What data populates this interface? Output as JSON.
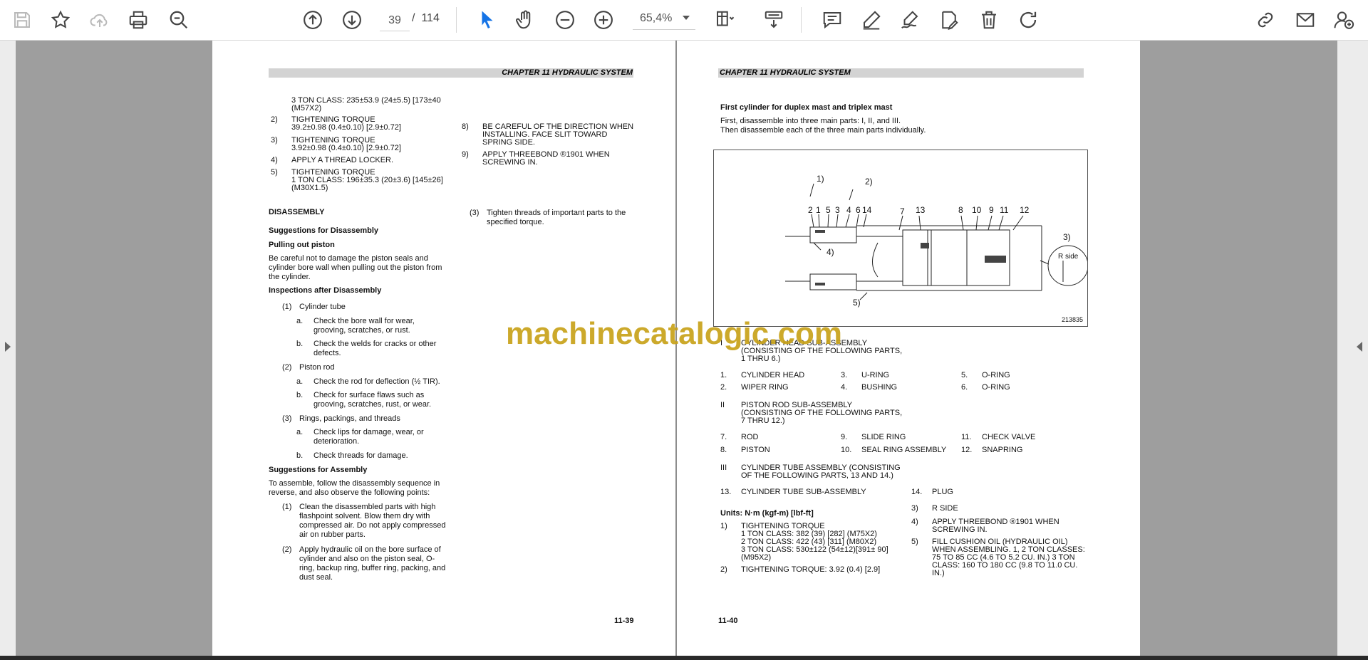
{
  "toolbar": {
    "icons": [
      "save-icon",
      "bookmark-star-icon",
      "cloud-upload-icon",
      "print-icon",
      "zoom-search-icon",
      "page-up-icon",
      "page-down-icon",
      "select-cursor-icon",
      "hand-tool-icon",
      "zoom-out-icon",
      "zoom-in-icon",
      "fit-page-icon",
      "scroll-mode-icon",
      "comment-icon",
      "highlight-pen-icon",
      "draw-sign-icon",
      "edit-text-icon",
      "delete-icon",
      "rotate-icon",
      "share-link-icon",
      "email-icon",
      "add-user-icon"
    ],
    "current_page": "39",
    "page_separator": "/",
    "total_pages": "114",
    "zoom": "65,4%"
  },
  "watermark": "machinecatalogic.com",
  "left_page": {
    "chapter": "CHAPTER 11 HYDRAULIC SYSTEM",
    "page_number": "11-39",
    "col1": {
      "t1a": "3 TON CLASS: 235±53.9 (24±5.5) [173±40",
      "t1b": "(M57X2)",
      "n2": "2)",
      "t2a": "TIGHTENING TORQUE",
      "t2b": "39.2±0.98 (0.4±0.10) [2.9±0.72]",
      "n3": "3)",
      "t3a": "TIGHTENING TORQUE",
      "t3b": "3.92±0.98 (0.4±0.10) [2.9±0.72]",
      "n4": "4)",
      "t4": "APPLY A THREAD LOCKER.",
      "n5": "5)",
      "t5a": "TIGHTENING TORQUE",
      "t5b": "1 TON CLASS: 196±35.3 (20±3.6) [145±26]",
      "t5c": "(M30X1.5)",
      "disassembly": "DISASSEMBLY",
      "sugg_dis": "Suggestions for Disassembly",
      "pulling": "Pulling out piston",
      "p1": "Be careful not to damage the piston seals and",
      "p2": "cylinder bore wall when pulling out the piston from",
      "p3": "the cylinder.",
      "inspections": "Inspections after Disassembly",
      "i1n": "(1)",
      "i1": "Cylinder tube",
      "i1an": "a.",
      "i1a1": "Check the bore wall for wear,",
      "i1a2": "grooving, scratches, or rust.",
      "i1bn": "b.",
      "i1b1": "Check the welds for cracks or other",
      "i1b2": "defects.",
      "i2n": "(2)",
      "i2": "Piston rod",
      "i2an": "a.",
      "i2a": "Check the rod for deflection (½ TIR).",
      "i2bn": "b.",
      "i2b1": "Check for surface flaws such as",
      "i2b2": "grooving, scratches, rust, or wear.",
      "i3n": "(3)",
      "i3": "Rings, packings, and threads",
      "i3an": "a.",
      "i3a1": "Check lips for damage, wear, or",
      "i3a2": "deterioration.",
      "i3bn": "b.",
      "i3b": "Check threads for damage.",
      "sugg_as": "Suggestions for Assembly",
      "as1": "To assemble, follow the disassembly sequence in",
      "as2": "reverse, and also observe the following points:",
      "a1n": "(1)",
      "a1a": "Clean the disassembled parts with high",
      "a1b": "flashpoint solvent. Blow them dry with",
      "a1c": "compressed air. Do not apply compressed",
      "a1d": "air on rubber parts.",
      "a2n": "(2)",
      "a2a": "Apply hydraulic oil on the bore surface of",
      "a2b": "cylinder and also on the piston seal, O-",
      "a2c": "ring, backup ring, buffer ring, packing, and",
      "a2d": "dust seal."
    },
    "col2": {
      "n8": "8)",
      "t8a": "BE CAREFUL OF THE DIRECTION WHEN",
      "t8b": "INSTALLING. FACE SLIT TOWARD",
      "t8c": "SPRING SIDE.",
      "n9": "9)",
      "t9a": "APPLY THREEBOND ®1901 WHEN",
      "t9b": "SCREWING IN.",
      "n3": "(3)",
      "t3a": "Tighten threads of important parts to the",
      "t3b": "specified torque."
    }
  },
  "right_page": {
    "chapter": "CHAPTER 11 HYDRAULIC SYSTEM",
    "page_number": "11-40",
    "heading": "First cylinder for duplex mast and triplex mast",
    "intro1": "First, disassemble into three main parts: I, II, and III.",
    "intro2": "Then disassemble each of the three main parts individually.",
    "diagram": {
      "callouts_top": [
        "2",
        "1",
        "5",
        "3",
        "4",
        "6",
        "14",
        "7",
        "13",
        "8",
        "10",
        "9",
        "11",
        "12"
      ],
      "callout_1": "1)",
      "callout_2": "2)",
      "callout_3": "3)",
      "callout_4": "4)",
      "callout_5": "5)",
      "r_side": "R side",
      "figure_id": "213835"
    },
    "grp1n": "I",
    "grp1a": "CYLINDER HEAD SUB-ASSEMBLY",
    "grp1b": "(CONSISTING OF THE FOLLOWING PARTS,",
    "grp1c": "1 THRU 6.)",
    "parts1": [
      {
        "n": "1.",
        "t": "CYLINDER HEAD"
      },
      {
        "n": "3.",
        "t": "U-RING"
      },
      {
        "n": "5.",
        "t": "O-RING"
      },
      {
        "n": "2.",
        "t": "WIPER RING"
      },
      {
        "n": "4.",
        "t": "BUSHING"
      },
      {
        "n": "6.",
        "t": "O-RING"
      }
    ],
    "grp2n": "II",
    "grp2a": "PISTON ROD SUB-ASSEMBLY",
    "grp2b": "(CONSISTING OF THE FOLLOWING PARTS,",
    "grp2c": "7 THRU 12.)",
    "parts2": [
      {
        "n": "7.",
        "t": "ROD"
      },
      {
        "n": "9.",
        "t": "SLIDE RING"
      },
      {
        "n": "11.",
        "t": "CHECK VALVE"
      },
      {
        "n": "8.",
        "t": "PISTON"
      },
      {
        "n": "10.",
        "t": "SEAL RING ASSEMBLY"
      },
      {
        "n": "12.",
        "t": "SNAPRING"
      }
    ],
    "grp3n": "III",
    "grp3a": "CYLINDER TUBE ASSEMBLY (CONSISTING",
    "grp3b": "OF THE FOLLOWING PARTS, 13 AND 14.)",
    "p13n": "13.",
    "p13": "CYLINDER TUBE SUB-ASSEMBLY",
    "p14n": "14.",
    "p14": "PLUG",
    "units": "Units: N·m (kgf-m) [lbf-ft]",
    "u1n": "1)",
    "u1a": "TIGHTENING TORQUE",
    "u1b": "1 TON CLASS: 382 (39) [282] (M75X2)",
    "u1c": "2 TON CLASS: 422 (43) [311] (M80X2)",
    "u1d": "3 TON CLASS: 530±122 (54±12)[391± 90]",
    "u1e": "(M95X2)",
    "u2n": "2)",
    "u2": "TIGHTENING TORQUE: 3.92 (0.4) [2.9]",
    "u3n": "3)",
    "u3": "R SIDE",
    "u4n": "4)",
    "u4a": "APPLY THREEBOND ®1901 WHEN",
    "u4b": "SCREWING IN.",
    "u5n": "5)",
    "u5a": "FILL CUSHION OIL (HYDRAULIC OIL)",
    "u5b": "WHEN ASSEMBLING. 1, 2 TON CLASSES:",
    "u5c": "75 TO 85 CC (4.6 TO 5.2 CU. IN.) 3 TON",
    "u5d": "CLASS: 160 TO 180 CC (9.8 TO 11.0 CU.",
    "u5e": "IN.)"
  }
}
